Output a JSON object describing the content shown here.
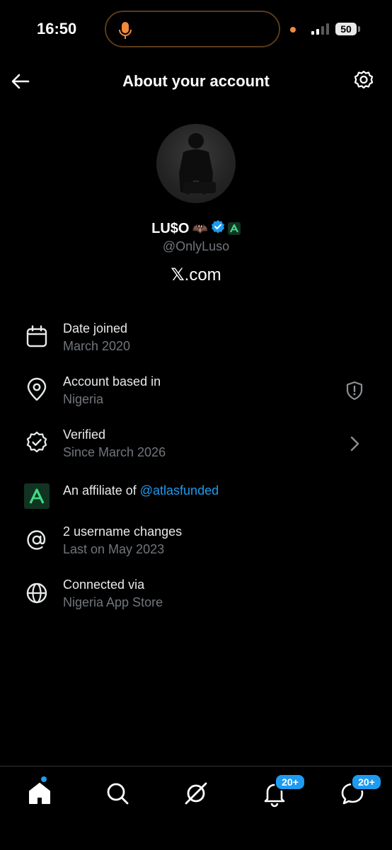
{
  "status_bar": {
    "time": "16:50",
    "battery": "50"
  },
  "header": {
    "title": "About your account"
  },
  "profile": {
    "name": "LU$O",
    "emoji": "🦇",
    "handle": "@OnlyLuso",
    "site_mark": "𝕏",
    "site_suffix": ".com"
  },
  "info": {
    "date_joined": {
      "label": "Date joined",
      "value": "March 2020"
    },
    "based_in": {
      "label": "Account based in",
      "value": "Nigeria"
    },
    "verified": {
      "label": "Verified",
      "value": "Since March 2026"
    },
    "affiliate": {
      "label": "An affiliate of ",
      "link": "@atlasfunded"
    },
    "username_changes": {
      "label": "2 username changes",
      "value": "Last on May 2023"
    },
    "connected_via": {
      "label": "Connected via",
      "value": "Nigeria App Store"
    }
  },
  "tabbar": {
    "notifications_count": "20+",
    "messages_count": "20+"
  },
  "colors": {
    "accent": "#1d9bf0",
    "secondary_text": "#71767b",
    "affiliate_bg": "#123322",
    "affiliate_fg": "#3ddc84"
  }
}
